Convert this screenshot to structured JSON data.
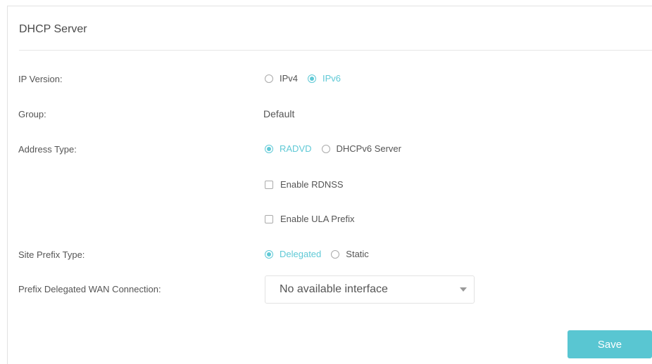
{
  "panel": {
    "title": "DHCP Server"
  },
  "ip_version": {
    "label": "IP Version:",
    "options": [
      {
        "label": "IPv4",
        "selected": false
      },
      {
        "label": "IPv6",
        "selected": true
      }
    ]
  },
  "group": {
    "label": "Group:",
    "value": "Default"
  },
  "address_type": {
    "label": "Address Type:",
    "options": [
      {
        "label": "RADVD",
        "selected": true
      },
      {
        "label": "DHCPv6 Server",
        "selected": false
      }
    ]
  },
  "checkboxes": {
    "rdnss": {
      "label": "Enable RDNSS",
      "checked": false
    },
    "ula": {
      "label": "Enable ULA Prefix",
      "checked": false
    }
  },
  "site_prefix_type": {
    "label": "Site Prefix Type:",
    "options": [
      {
        "label": "Delegated",
        "selected": true
      },
      {
        "label": "Static",
        "selected": false
      }
    ]
  },
  "prefix_wan": {
    "label": "Prefix Delegated WAN Connection:",
    "selected_value": "No available interface"
  },
  "actions": {
    "save_label": "Save"
  },
  "colors": {
    "accent": "#5fc9d6",
    "button": "#59c6d2",
    "text": "#555555"
  }
}
